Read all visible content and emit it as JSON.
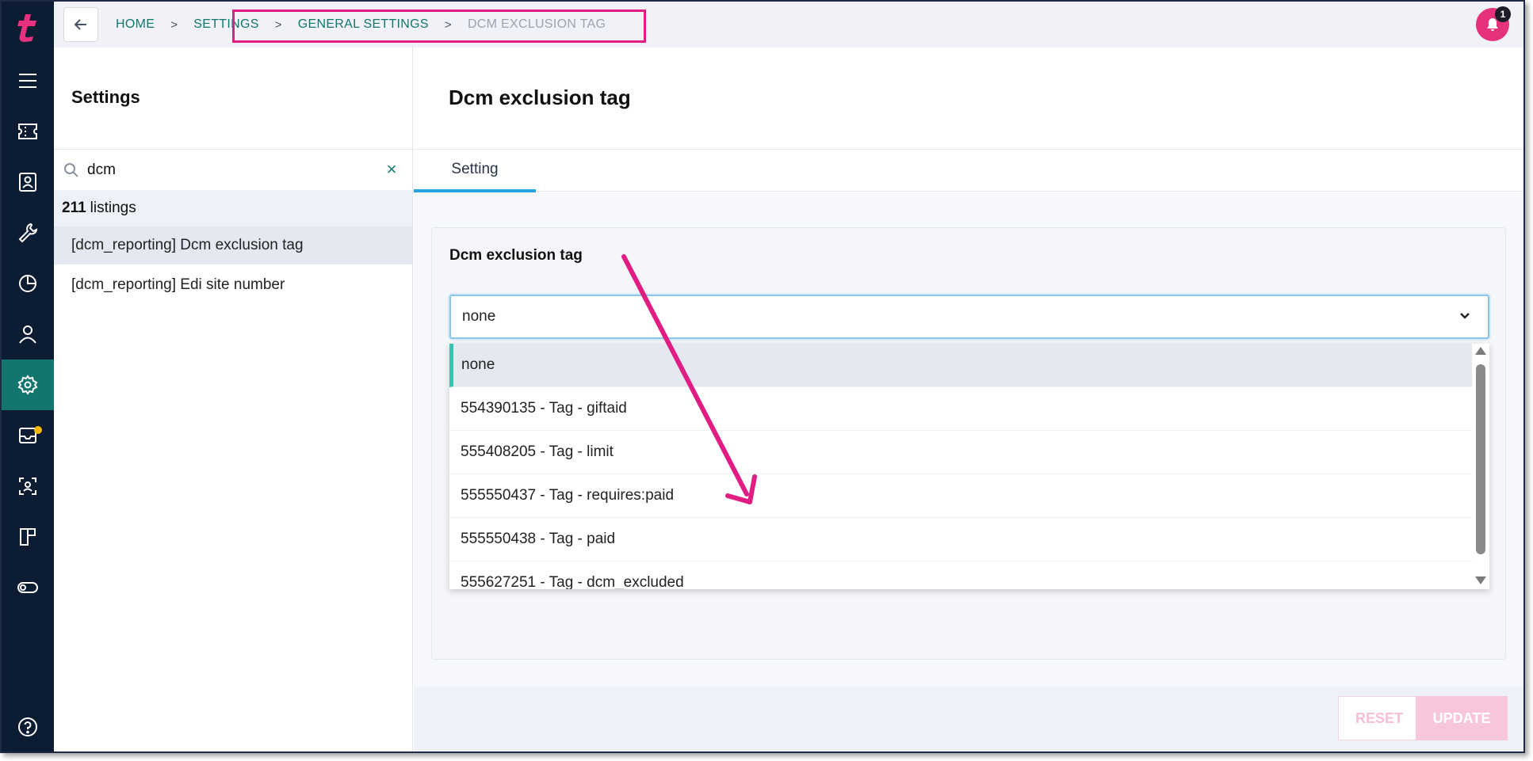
{
  "breadcrumb": {
    "items": [
      "HOME",
      "SETTINGS",
      "GENERAL SETTINGS",
      "DCM EXCLUSION TAG"
    ]
  },
  "notifications": {
    "count": "1"
  },
  "settings_panel": {
    "title": "Settings",
    "search": {
      "value": "dcm",
      "placeholder": ""
    },
    "listing_count": "211",
    "listing_label": "listings",
    "items": [
      {
        "label": "[dcm_reporting] Dcm exclusion tag",
        "selected": true
      },
      {
        "label": "[dcm_reporting] Edi site number",
        "selected": false
      }
    ]
  },
  "main": {
    "title": "Dcm exclusion tag",
    "tabs": [
      {
        "label": "Setting"
      }
    ],
    "field_label": "Dcm exclusion tag",
    "select_value": "none",
    "options": [
      "none",
      "554390135 - Tag - giftaid",
      "555408205 - Tag - limit",
      "555550437 - Tag - requires:paid",
      "555550438 - Tag - paid",
      "555627251 - Tag - dcm_excluded"
    ],
    "buttons": {
      "reset": "RESET",
      "update": "UPDATE"
    }
  },
  "colors": {
    "nav_bg": "#0c1c33",
    "accent": "#12766e",
    "brand": "#e6317c",
    "annotation": "#e11d84"
  }
}
